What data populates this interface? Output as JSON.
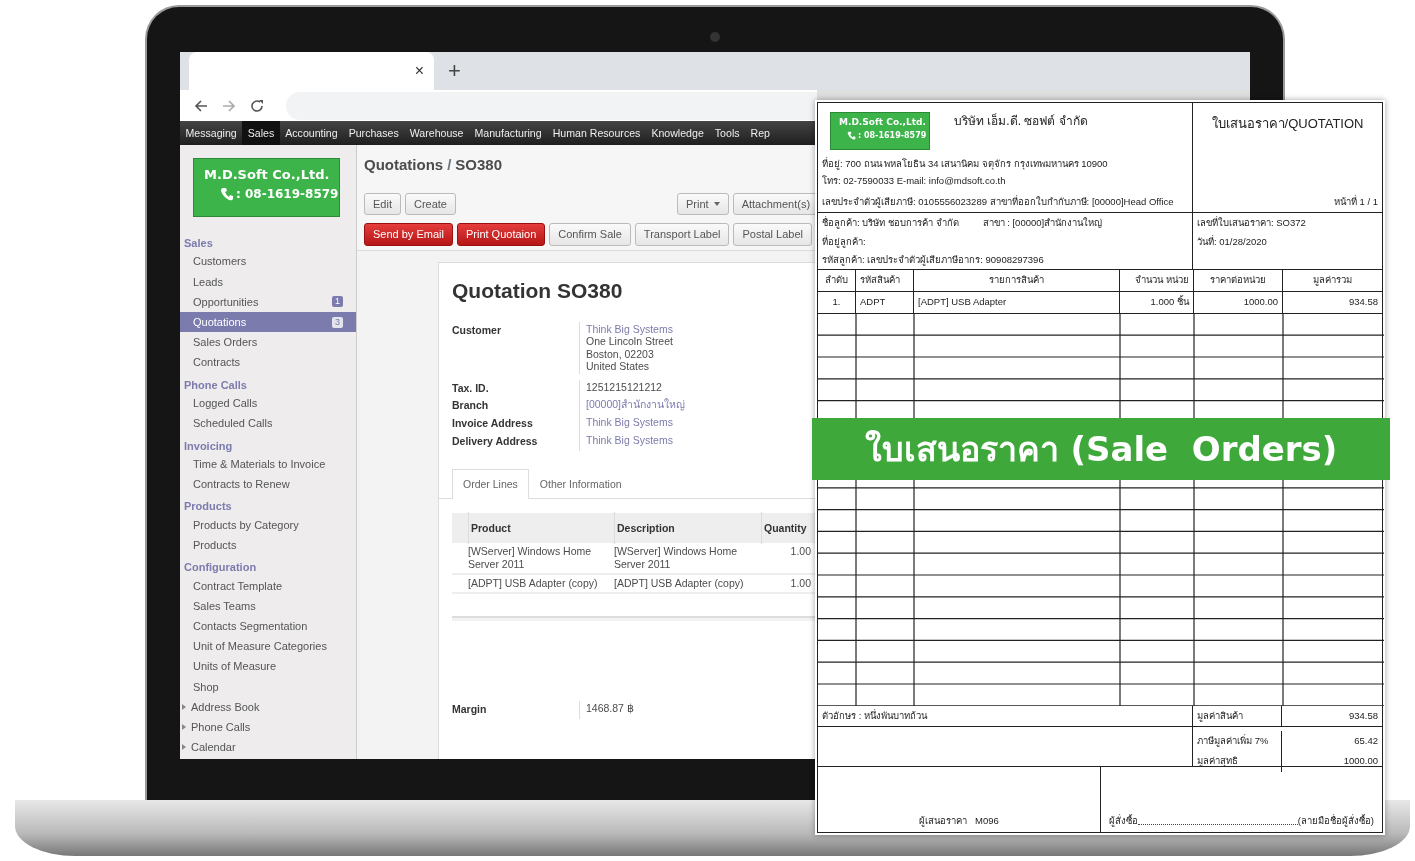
{
  "browser": {
    "tab_close": "×",
    "new_tab": "+"
  },
  "menu": [
    {
      "label": "Messaging",
      "selected": false
    },
    {
      "label": "Sales",
      "selected": true
    },
    {
      "label": "Accounting",
      "selected": false
    },
    {
      "label": "Purchases",
      "selected": false
    },
    {
      "label": "Warehouse",
      "selected": false
    },
    {
      "label": "Manufacturing",
      "selected": false
    },
    {
      "label": "Human Resources",
      "selected": false
    },
    {
      "label": "Knowledge",
      "selected": false
    },
    {
      "label": "Tools",
      "selected": false
    },
    {
      "label": "Rep",
      "selected": false
    }
  ],
  "sidebar": {
    "logo": {
      "company": "M.D.Soft Co.,Ltd.",
      "phone": ": 08-1619-8579"
    },
    "sections": [
      {
        "title": "Sales",
        "items": [
          {
            "label": "Customers",
            "selected": false
          },
          {
            "label": "Leads",
            "selected": false
          },
          {
            "label": "Opportunities",
            "selected": false,
            "badge": "1"
          },
          {
            "label": "Quotations",
            "selected": true,
            "badge": "3"
          },
          {
            "label": "Sales Orders",
            "selected": false
          },
          {
            "label": "Contracts",
            "selected": false
          }
        ]
      },
      {
        "title": "Phone Calls",
        "items": [
          {
            "label": "Logged Calls",
            "selected": false
          },
          {
            "label": "Scheduled Calls",
            "selected": false
          }
        ]
      },
      {
        "title": "Invoicing",
        "items": [
          {
            "label": "Time & Materials to Invoice",
            "selected": false
          },
          {
            "label": "Contracts to Renew",
            "selected": false
          }
        ]
      },
      {
        "title": "Products",
        "items": [
          {
            "label": "Products by Category",
            "selected": false
          },
          {
            "label": "Products",
            "selected": false
          }
        ]
      },
      {
        "title": "Configuration",
        "items": [
          {
            "label": "Contract Template",
            "selected": false
          },
          {
            "label": "Sales Teams",
            "selected": false
          },
          {
            "label": "Contacts Segmentation",
            "selected": false
          },
          {
            "label": "Unit of Measure Categories",
            "selected": false
          },
          {
            "label": "Units of Measure",
            "selected": false
          },
          {
            "label": "Shop",
            "selected": false
          }
        ]
      }
    ],
    "folders": [
      {
        "label": "Address Book",
        "expanded": false
      },
      {
        "label": "Phone Calls",
        "expanded": false
      },
      {
        "label": "Calendar",
        "expanded": false
      }
    ]
  },
  "breadcrumb": {
    "parent": "Quotations",
    "separator": "/",
    "current": "SO380"
  },
  "buttons": [
    {
      "label": "Edit",
      "kind": "plain"
    },
    {
      "label": "Create",
      "kind": "plain"
    },
    {
      "label": "Print",
      "kind": "dropdown"
    },
    {
      "label": "Attachment(s)",
      "kind": "dropdown"
    }
  ],
  "actions": [
    {
      "label": "Send by Email",
      "kind": "highlight"
    },
    {
      "label": "Print Quotaion",
      "kind": "highlight"
    },
    {
      "label": "Confirm Sale",
      "kind": "plain"
    },
    {
      "label": "Transport Label",
      "kind": "plain"
    },
    {
      "label": "Postal Label",
      "kind": "plain"
    }
  ],
  "form": {
    "title": "Quotation SO380",
    "fields": [
      {
        "label": "Customer",
        "values": [
          {
            "text": "Think Big Systems",
            "kind": "link"
          },
          {
            "text": "One Lincoln Street",
            "kind": "text"
          },
          {
            "text": "Boston, 02203",
            "kind": "text"
          },
          {
            "text": "United States",
            "kind": "text"
          }
        ]
      },
      {
        "label": "Tax. ID.",
        "values": [
          {
            "text": "1251215121212",
            "kind": "text"
          }
        ]
      },
      {
        "label": "Branch",
        "values": [
          {
            "text": "[00000]สำนักงานใหญ่",
            "kind": "link"
          }
        ]
      },
      {
        "label": "Invoice Address",
        "values": [
          {
            "text": "Think Big Systems",
            "kind": "link"
          }
        ]
      },
      {
        "label": "Delivery Address",
        "values": [
          {
            "text": "Think Big Systems",
            "kind": "link"
          }
        ]
      }
    ],
    "tabs": [
      {
        "label": "Order Lines",
        "selected": true
      },
      {
        "label": "Other Information",
        "selected": false
      }
    ],
    "order_lines": {
      "columns": [
        "Product",
        "Description",
        "Quantity"
      ],
      "rows": [
        {
          "product": "[WServer] Windows Home Server 2011",
          "description": "[WServer] Windows Home Server 2011",
          "quantity": "1.00"
        },
        {
          "product": "[ADPT] USB Adapter (copy)",
          "description": "[ADPT] USB Adapter (copy)",
          "quantity": "1.00"
        }
      ]
    },
    "summary": [
      {
        "label": "Margin",
        "value": "1468.87 ฿"
      }
    ]
  },
  "document": {
    "logo": {
      "company": "M.D.Soft Co.,Ltd.",
      "phone": ": 08-1619-8579"
    },
    "company": "บริษัท เอ็ม.ดี. ซอฟต์ จำกัด",
    "address_lines": [
      "ที่อยู่: 700 ถนน พหลโยธิน 34 เสนานิคม จตุจักร กรุงเทพมหานคร 10900",
      "โทร: 02-7590033 E-mail: info@mdsoft.co.th"
    ],
    "tax_line": "เลขประจำตัวผู้เสียภาษี: 0105556023289 สาขาที่ออกใบกำกับภาษี: [00000]Head Office",
    "title": "ใบเสนอราคา/QUOTATION",
    "page": "หน้าที่ 1 / 1",
    "customer": {
      "name": "ชื่อลูกค้า: บริษัท ชอบการค้า จำกัด",
      "branch": "สาขา : [00000]สำนักงานใหญ่",
      "address": "ที่อยู่ลูกค้า:",
      "code": "รหัสลูกค้า: เลขประจำตัวผู้เสียภาษีอากร: 90908297396"
    },
    "quote_info": [
      "เลขที่ใบเสนอราคา: SO372",
      "วันที่: 01/28/2020"
    ],
    "columns": [
      "ลำดับ",
      "รหัสสินค้า",
      "รายการสินค้า",
      "จำนวน หน่วย",
      "ราคาต่อหน่วย",
      "มูลค่ารวม"
    ],
    "rows": [
      [
        "1.",
        "ADPT",
        "[ADPT] USB Adapter",
        "1.000 ชิ้น",
        "1000.00",
        "934.58"
      ]
    ],
    "amount_words": "ตัวอักษร : หนึ่งพันบาทถ้วน",
    "totals": [
      {
        "label": "มูลค่าสินค้า",
        "value": "934.58"
      },
      {
        "label": "ภาษีมูลค่าเพิ่ม 7%",
        "value": "65.42"
      },
      {
        "label": "มูลค่าสุทธิ",
        "value": "1000.00"
      }
    ],
    "seller_sign": "ผู้เสนอราคา   M096",
    "buyer_sign": {
      "signer": "ผู้สั่งซื้อ",
      "note": "(ลายมือชื่อผู้สั่งซื้อ)"
    }
  },
  "banner": "ใบเสนอราคา (Sale  Orders)"
}
